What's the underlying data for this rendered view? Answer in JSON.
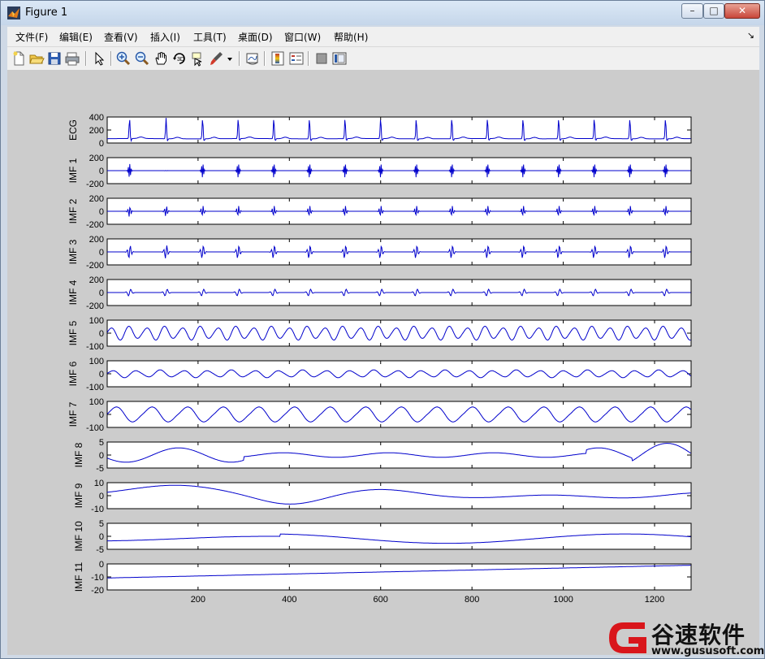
{
  "window": {
    "title": "Figure 1",
    "controls": {
      "minimize": "–",
      "maximize": "□",
      "close": "✕"
    }
  },
  "menu": {
    "items": [
      "文件(F)",
      "编辑(E)",
      "查看(V)",
      "插入(I)",
      "工具(T)",
      "桌面(D)",
      "窗口(W)",
      "帮助(H)"
    ],
    "overflow": "↘"
  },
  "toolbar": {
    "icons": [
      "new-figure-icon",
      "open-file-icon",
      "save-icon",
      "print-icon",
      "select-arrow-icon",
      "zoom-in-icon",
      "zoom-out-icon",
      "pan-hand-icon",
      "rotate-3d-icon",
      "data-cursor-icon",
      "brush-icon",
      "brush-dropdown-icon",
      "link-plot-icon",
      "colorbar-icon",
      "legend-icon",
      "hide-plot-tools-icon",
      "show-plot-tools-icon"
    ]
  },
  "colors": {
    "line": "#0000cc",
    "figure_bg": "#cccccc",
    "axes_bg": "#ffffff"
  },
  "chart_data": {
    "type": "line",
    "x_range": [
      1,
      1280
    ],
    "x_ticks": [
      200,
      400,
      600,
      800,
      1000,
      1200
    ],
    "beat_positions": [
      50,
      130,
      210,
      288,
      366,
      444,
      522,
      600,
      678,
      756,
      834,
      912,
      990,
      1068,
      1146,
      1224
    ],
    "subplots": [
      {
        "ylabel": "ECG",
        "ylim": [
          -100,
          500
        ],
        "yticks": [
          "400",
          "200",
          "0"
        ],
        "signal": "ecg",
        "amp": 480
      },
      {
        "ylabel": "IMF 1",
        "ylim": [
          -200,
          200
        ],
        "yticks": [
          "200",
          "0",
          "-200"
        ],
        "signal": "burst",
        "amp": 120,
        "freq": 0.35
      },
      {
        "ylabel": "IMF 2",
        "ylim": [
          -200,
          200
        ],
        "yticks": [
          "200",
          "0",
          "-200"
        ],
        "signal": "burst",
        "amp": 90,
        "freq": 0.22
      },
      {
        "ylabel": "IMF 3",
        "ylim": [
          -200,
          200
        ],
        "yticks": [
          "200",
          "0",
          "-200"
        ],
        "signal": "burst",
        "amp": 110,
        "freq": 0.15
      },
      {
        "ylabel": "IMF 4",
        "ylim": [
          -200,
          200
        ],
        "yticks": [
          "200",
          "0",
          "-200"
        ],
        "signal": "burst",
        "amp": 60,
        "freq": 0.09
      },
      {
        "ylabel": "IMF 5",
        "ylim": [
          -100,
          100
        ],
        "yticks": [
          "100",
          "0",
          "-100"
        ],
        "signal": "wave",
        "amp": 55,
        "period": 39
      },
      {
        "ylabel": "IMF 6",
        "ylim": [
          -100,
          100
        ],
        "yticks": [
          "100",
          "0",
          "-100"
        ],
        "signal": "wave",
        "amp": 30,
        "period": 52
      },
      {
        "ylabel": "IMF 7",
        "ylim": [
          -100,
          100
        ],
        "yticks": [
          "100",
          "0",
          "-100"
        ],
        "signal": "wave",
        "amp": 65,
        "period": 78
      },
      {
        "ylabel": "IMF 8",
        "ylim": [
          -5,
          5
        ],
        "yticks": [
          "5",
          "0",
          "-5"
        ],
        "signal": "slow8"
      },
      {
        "ylabel": "IMF 9",
        "ylim": [
          -10,
          10
        ],
        "yticks": [
          "10",
          "0",
          "-10"
        ],
        "signal": "slow9"
      },
      {
        "ylabel": "IMF 10",
        "ylim": [
          -5,
          5
        ],
        "yticks": [
          "5",
          "0",
          "-5"
        ],
        "signal": "slow10"
      },
      {
        "ylabel": "IMF 11",
        "ylim": [
          -20,
          0
        ],
        "yticks": [
          "0",
          "-10",
          "-20"
        ],
        "signal": "trend"
      }
    ]
  },
  "watermark": {
    "brand": "谷速软件",
    "url": "www.gususoft.com"
  }
}
